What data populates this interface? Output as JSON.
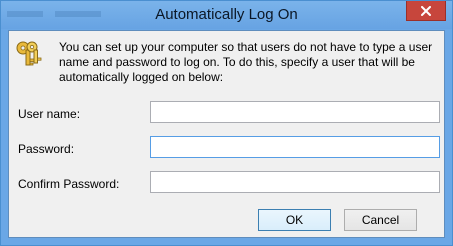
{
  "window": {
    "title": "Automatically Log On",
    "close_icon": "close-icon"
  },
  "intro": {
    "icon": "keys-icon",
    "text": "You can set up your computer so that users do not have to type a user name and password to log on. To do this, specify a user that will be automatically logged on below:"
  },
  "form": {
    "user_name_label": "User name:",
    "user_name_value": "",
    "password_label": "Password:",
    "password_value": "",
    "confirm_label": "Confirm Password:",
    "confirm_value": ""
  },
  "buttons": {
    "ok_label": "OK",
    "cancel_label": "Cancel"
  },
  "colors": {
    "titlebar": "#6aa7e6",
    "close_button": "#c7463c",
    "client_background": "#f0f0f0"
  }
}
